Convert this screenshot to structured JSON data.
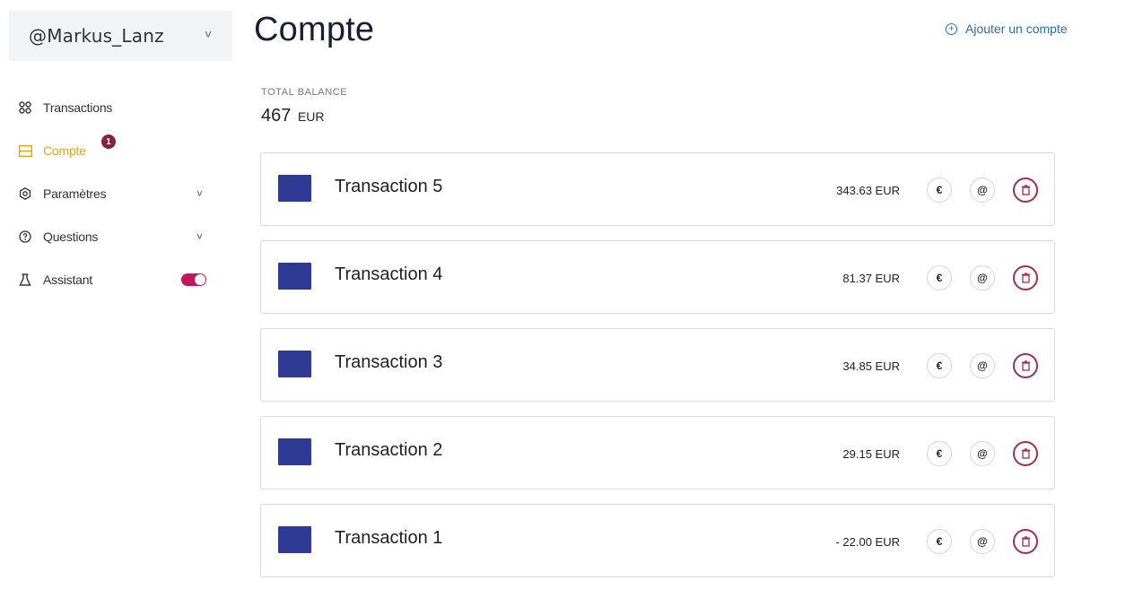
{
  "account": {
    "name": "@Markus_Lanz",
    "chevron": "˅"
  },
  "nav": {
    "items": [
      {
        "label": "Transactions",
        "icon": "grid-icon"
      },
      {
        "label": "Compte",
        "icon": "table-icon",
        "active": true,
        "badge": "1"
      },
      {
        "label": "Paramètres",
        "icon": "settings-icon",
        "chevron": "˅"
      },
      {
        "label": "Questions",
        "icon": "help-icon",
        "chevron": "˅"
      },
      {
        "label": "Assistant",
        "icon": "flask-icon",
        "toggle": true
      }
    ]
  },
  "page": {
    "title": "Compte"
  },
  "add_account": {
    "label": "Ajouter un compte",
    "icon": "plus-circle-icon",
    "symbol": "+"
  },
  "balance": {
    "label": "TOTAL BALANCE",
    "value": "467",
    "currency": "EUR"
  },
  "transactions": [
    {
      "name": "Transaction 5",
      "amount": "343.63 EUR"
    },
    {
      "name": "Transaction 4",
      "amount": "81.37 EUR"
    },
    {
      "name": "Transaction 3",
      "amount": "34.85 EUR"
    },
    {
      "name": "Transaction 2",
      "amount": "29.15 EUR"
    },
    {
      "name": "Transaction 1",
      "amount": "- 22.00 EUR"
    }
  ],
  "actions": {
    "euro_symbol": "€",
    "at_symbol": "@",
    "trash_symbol": "🗑"
  },
  "colors": {
    "active": "#e8a317",
    "badge": "#8a1f3c",
    "toggle": "#c2185b",
    "link": "#2a6fb0",
    "thumbnail": "#2e3a94",
    "delete": "#a0304f"
  }
}
